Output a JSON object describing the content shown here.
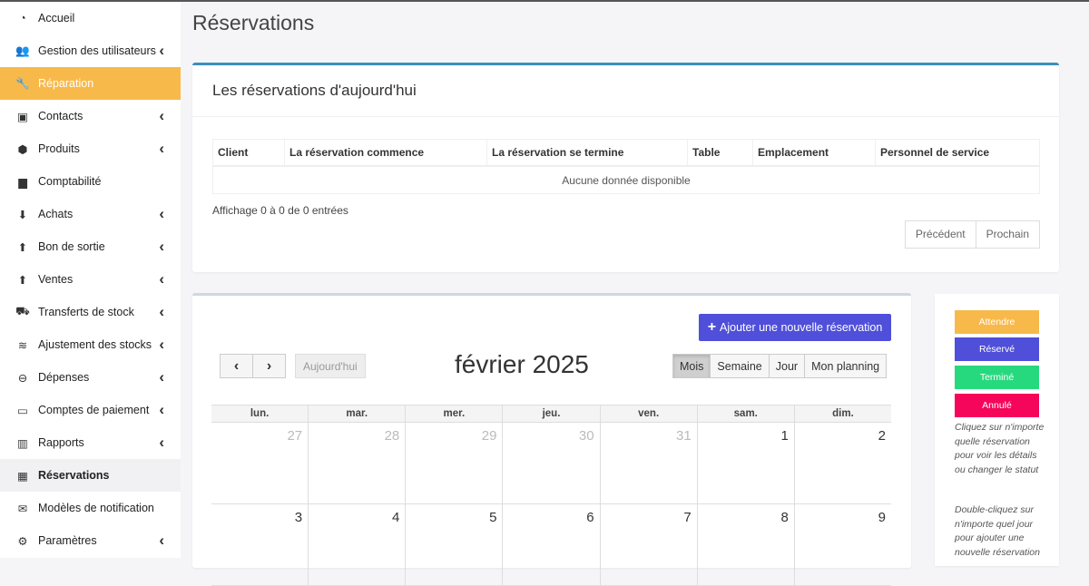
{
  "sidebar": {
    "items": [
      {
        "label": "Accueil",
        "icon": "dashboard-icon",
        "chevron": false
      },
      {
        "label": "Gestion des utilisateurs",
        "icon": "users-icon",
        "chevron": true
      },
      {
        "label": "Réparation",
        "icon": "wrench-icon",
        "chevron": false
      },
      {
        "label": "Contacts",
        "icon": "address-book-icon",
        "chevron": true
      },
      {
        "label": "Produits",
        "icon": "cubes-icon",
        "chevron": true
      },
      {
        "label": "Comptabilité",
        "icon": "book-icon",
        "chevron": false
      },
      {
        "label": "Achats",
        "icon": "arrow-circle-down-icon",
        "chevron": true
      },
      {
        "label": "Bon de sortie",
        "icon": "arrow-circle-up-icon",
        "chevron": true
      },
      {
        "label": "Ventes",
        "icon": "arrow-circle-up-icon",
        "chevron": true
      },
      {
        "label": "Transferts de stock",
        "icon": "truck-icon",
        "chevron": true
      },
      {
        "label": "Ajustement des stocks",
        "icon": "database-icon",
        "chevron": true
      },
      {
        "label": "Dépenses",
        "icon": "minus-circle-icon",
        "chevron": true
      },
      {
        "label": "Comptes de paiement",
        "icon": "money-icon",
        "chevron": true
      },
      {
        "label": "Rapports",
        "icon": "bar-chart-icon",
        "chevron": true
      },
      {
        "label": "Réservations",
        "icon": "calendar-check-icon",
        "chevron": false
      },
      {
        "label": "Modèles de notification",
        "icon": "envelope-icon",
        "chevron": false
      },
      {
        "label": "Paramètres",
        "icon": "cog-icon",
        "chevron": true
      }
    ],
    "highlight_color": "#f8b94b"
  },
  "page": {
    "title": "Réservations"
  },
  "today_box": {
    "title": "Les réservations d'aujourd'hui",
    "columns": [
      "Client",
      "La réservation commence",
      "La réservation se termine",
      "Table",
      "Emplacement",
      "Personnel de service"
    ],
    "empty_text": "Aucune donnée disponible",
    "info": "Affichage 0 à 0 de 0 entrées",
    "prev": "Précédent",
    "next": "Prochain",
    "accent_color": "#3c8dbc"
  },
  "calendar": {
    "add_button": "Ajouter une nouvelle réservation",
    "today_button": "Aujourd'hui",
    "prev_symbol": "‹",
    "next_symbol": "›",
    "title": "février 2025",
    "views": [
      "Mois",
      "Semaine",
      "Jour",
      "Mon planning"
    ],
    "active_view": "Mois",
    "weekdays": [
      "lun.",
      "mar.",
      "mer.",
      "jeu.",
      "ven.",
      "sam.",
      "dim."
    ],
    "weeks": [
      [
        {
          "d": "27",
          "other": true
        },
        {
          "d": "28",
          "other": true
        },
        {
          "d": "29",
          "other": true
        },
        {
          "d": "30",
          "other": true
        },
        {
          "d": "31",
          "other": true
        },
        {
          "d": "1",
          "other": false
        },
        {
          "d": "2",
          "other": false
        }
      ],
      [
        {
          "d": "3",
          "other": false
        },
        {
          "d": "4",
          "other": false
        },
        {
          "d": "5",
          "other": false
        },
        {
          "d": "6",
          "other": false
        },
        {
          "d": "7",
          "other": false
        },
        {
          "d": "8",
          "other": false
        },
        {
          "d": "9",
          "other": false
        }
      ]
    ],
    "button_color": "#4f4fd9"
  },
  "legend": {
    "items": [
      {
        "label": "Attendre",
        "color": "#f8b94b"
      },
      {
        "label": "Réservé",
        "color": "#4f4fd9"
      },
      {
        "label": "Terminé",
        "color": "#27d97e"
      },
      {
        "label": "Annulé",
        "color": "#f5065a"
      }
    ],
    "note1": "Cliquez sur n'importe quelle réservation pour voir les détails ou changer le statut",
    "note2": "Double-cliquez sur n'importe quel jour pour ajouter une nouvelle réservation"
  }
}
